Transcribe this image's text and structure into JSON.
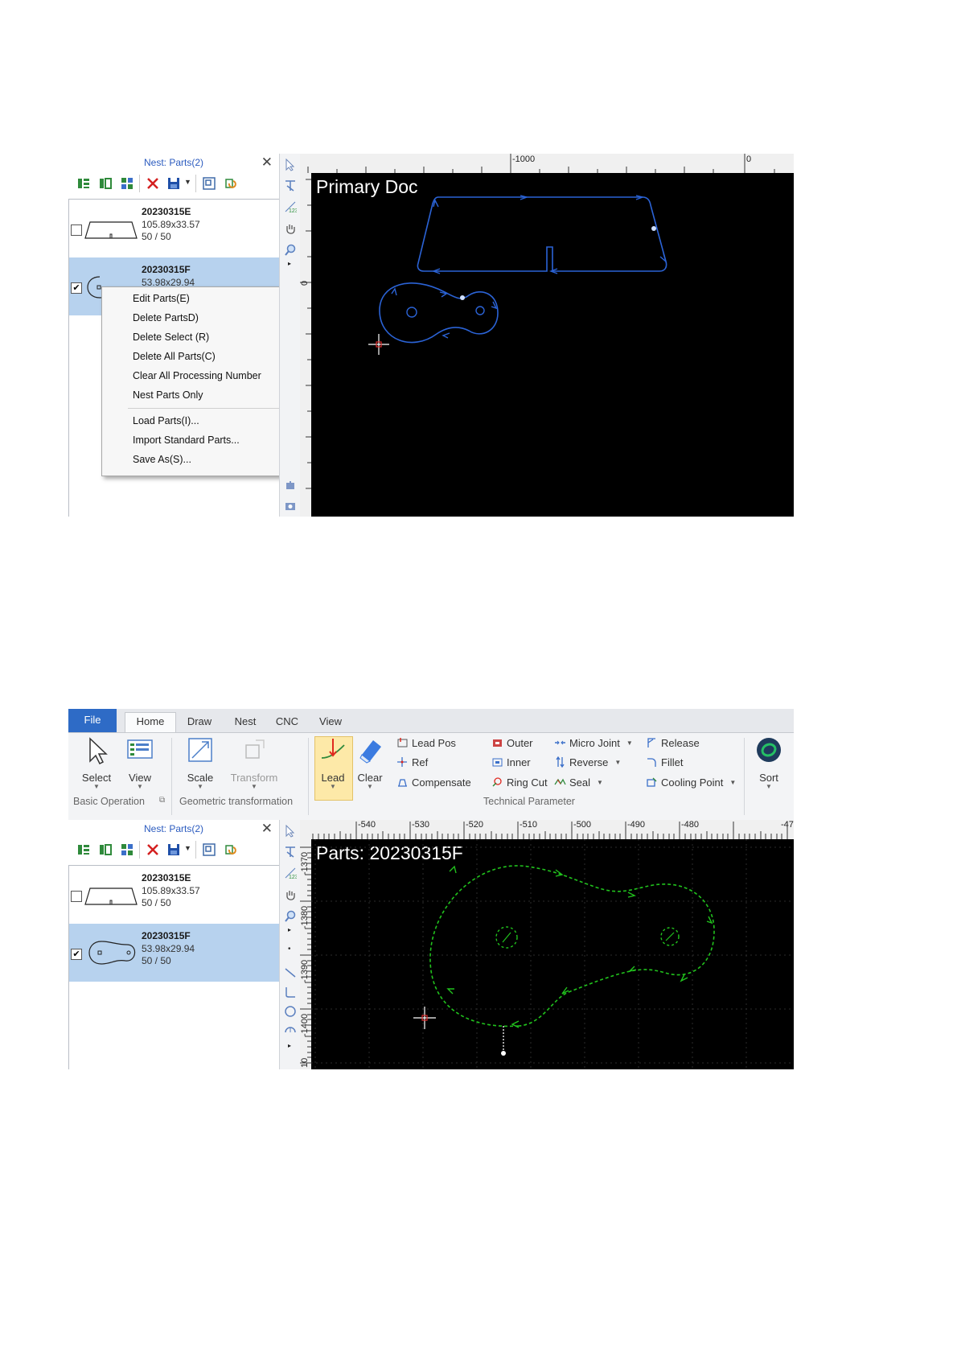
{
  "colors": {
    "ribbon_file_tab": "#2e6bc6",
    "panel_title": "#2b5bbf",
    "selection": "#b7d2ee",
    "canvas_bg": "#000000",
    "primary_path": "#2b63d6",
    "part_path": "#21c21d",
    "lead_highlight": "#fde9a8"
  },
  "shot1": {
    "panel": {
      "title": "Nest: Parts(2)",
      "close_icon": "close-icon",
      "toolbar_icons": [
        "list-view-icon",
        "detail-view-icon",
        "grid-view-icon",
        "delete-icon",
        "save-icon",
        "dropdown-icon",
        "layout-icon",
        "refresh-icon"
      ],
      "items": [
        {
          "name": "20230315E",
          "dims": "105.89x33.57",
          "count": "50 / 50",
          "checked": false
        },
        {
          "name": "20230315F",
          "dims": "53.98x29.94",
          "checked": true
        }
      ]
    },
    "context_menu": {
      "items": [
        "Edit Parts(E)",
        "Delete PartsD)",
        "Delete Select (R)",
        "Delete All Parts(C)",
        "Clear All Processing Number",
        "Nest Parts Only",
        "Load Parts(I)...",
        "Import Standard Parts...",
        "Save As(S)..."
      ]
    },
    "ruler": {
      "h_labels": [
        "-1000",
        "0"
      ],
      "v_labels": [
        "0"
      ]
    },
    "canvas": {
      "title": "Primary Doc"
    }
  },
  "shot2": {
    "ribbon": {
      "tabs": [
        "File",
        "Home",
        "Draw",
        "Nest",
        "CNC",
        "View"
      ],
      "active_tab": "Home",
      "basic": {
        "select": "Select",
        "view": "View",
        "group": "Basic Operation"
      },
      "geometric": {
        "scale": "Scale",
        "transform": "Transform",
        "group": "Geometric transformation"
      },
      "technical": {
        "lead": "Lead",
        "clear": "Clear",
        "lead_pos": "Lead Pos",
        "ref": "Ref",
        "compensate": "Compensate",
        "outer": "Outer",
        "inner": "Inner",
        "ring_cut": "Ring Cut",
        "micro_joint": "Micro Joint",
        "reverse": "Reverse",
        "seal": "Seal",
        "release": "Release",
        "fillet": "Fillet",
        "cooling_point": "Cooling Point",
        "group": "Technical Parameter"
      },
      "sort": "Sort"
    },
    "panel": {
      "title": "Nest: Parts(2)",
      "items": [
        {
          "name": "20230315E",
          "dims": "105.89x33.57",
          "count": "50 / 50",
          "checked": false
        },
        {
          "name": "20230315F",
          "dims": "53.98x29.94",
          "count": "50 / 50",
          "checked": true
        }
      ]
    },
    "ruler": {
      "h_labels": [
        "-540",
        "-530",
        "-520",
        "-510",
        "-500",
        "-490",
        "-480",
        "-47"
      ],
      "v_labels": [
        "-1370",
        "-1380",
        "-1390",
        "-1400",
        "10"
      ]
    },
    "canvas": {
      "title": "Parts: 20230315F"
    }
  }
}
